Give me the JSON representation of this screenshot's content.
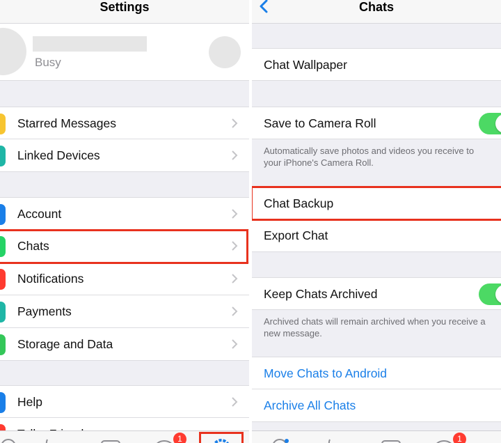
{
  "left": {
    "title": "Settings",
    "profile": {
      "status": "Busy"
    },
    "groups": [
      [
        {
          "label": "Starred Messages",
          "icon": "star-icon",
          "color": "#f7c531"
        },
        {
          "label": "Linked Devices",
          "icon": "laptop-icon",
          "color": "#1fb6a6"
        }
      ],
      [
        {
          "label": "Account",
          "icon": "key-icon",
          "color": "#1a7fe8"
        },
        {
          "label": "Chats",
          "icon": "whatsapp-icon",
          "color": "#25d366"
        },
        {
          "label": "Notifications",
          "icon": "bell-icon",
          "color": "#ff3b30"
        },
        {
          "label": "Payments",
          "icon": "rupee-icon",
          "color": "#1fb6a6"
        },
        {
          "label": "Storage and Data",
          "icon": "arrows-icon",
          "color": "#34c759"
        }
      ],
      [
        {
          "label": "Help",
          "icon": "info-icon",
          "color": "#1a7fe8"
        },
        {
          "label": "Tell a Friend",
          "icon": "heart-icon",
          "color": "#ff3b30"
        }
      ]
    ],
    "tabs": [
      {
        "icon": "status-icon"
      },
      {
        "icon": "calls-icon"
      },
      {
        "icon": "camera-icon"
      },
      {
        "icon": "chats-icon",
        "badge": "1"
      },
      {
        "icon": "settings-gear-icon",
        "active": true
      }
    ],
    "accent": "#1a7fe8",
    "highlight_color": "#e8321e"
  },
  "right": {
    "title": "Chats",
    "chat_wallpaper": "Chat Wallpaper",
    "save_to_camera_roll": "Save to Camera Roll",
    "save_note_line1": "Automatically save photos and videos you receive to",
    "save_note_line2": "your iPhone's Camera Roll.",
    "chat_backup": "Chat Backup",
    "export_chat": "Export Chat",
    "keep_archived": "Keep Chats Archived",
    "archived_note_line1": "Archived chats will remain archived when you receive a",
    "archived_note_line2": "new message.",
    "move_to_android": "Move Chats to Android",
    "archive_all": "Archive All Chats",
    "tabs": [
      {
        "icon": "status-icon"
      },
      {
        "icon": "calls-icon"
      },
      {
        "icon": "camera-icon"
      },
      {
        "icon": "chats-icon",
        "badge": "1"
      }
    ],
    "toggle_on_color": "#4cd964"
  }
}
